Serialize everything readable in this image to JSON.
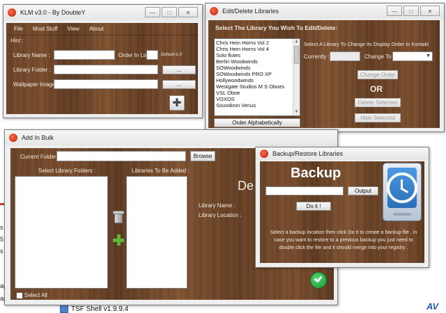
{
  "background": {
    "fragments": [
      "s",
      "5",
      "s v",
      "ap",
      "ap"
    ],
    "taskbar_item": "TSF Shell v1.9.9.4"
  },
  "klm": {
    "title": "KLM v3.0 - By DoubleY",
    "menu": [
      "File",
      "Most Stuff",
      "View",
      "About"
    ],
    "hint_label": "Hint :",
    "library_name_label": "Library Name :",
    "order_in_list_label": "Order In List",
    "default_note": "Default is 0",
    "library_folder_label": "Library Folder :",
    "wallpaper_label": "Wallpaper Image :",
    "browse_label": "...",
    "add_symbol": "✚"
  },
  "edit": {
    "title": "Edit/Delete Libraries",
    "heading": "Select The Library You Wish To Edit/Delete:",
    "libraries": [
      "Chris Hein Horns Vol 2",
      "Chris Hein Horns Vol 4",
      "Solo flutes",
      "Berlin Woodwinds",
      "SOWoodwinds",
      "SOWoodwinds PRO XP",
      "Hollywoodwinds",
      "Westgate Studios M S Oboes",
      "VSL Oboe",
      "VOXOS",
      "Soundiron Venus"
    ],
    "order_button": "Order Alphabetically",
    "order_hint": "Select A Library  To Change Its Display Order In Kontakt",
    "currently_label": "Currently :",
    "change_to_label": "Change To :",
    "change_order_button": "Change Order",
    "or_label": "OR",
    "delete_button": "Delete Selected",
    "hide_button": "Hide Selected"
  },
  "bulk": {
    "title": "Add In Bulk",
    "current_folder_label": "Current Folder :",
    "browse_button": "Browse",
    "select_folders_label": "Select Library Folders :",
    "to_be_added_label": "Libraries To Be Added :",
    "big_text": "De",
    "library_name_label": "Library Name :",
    "library_location_label": "Library Location :",
    "select_all_label": "Select All"
  },
  "backup": {
    "title": "Backup/Restore Libraries",
    "heading": "Backup",
    "output_button": "Output",
    "doit_button": "Do it !",
    "instructions": "Select a backup location then click Do It to create a backup file , in case you want to restore to a previous backup you just need to double click the file and it should merge into your registry ."
  },
  "logo_text": "AV",
  "colors": {
    "accent_red": "#c23a2f",
    "wood": "#6b4326",
    "check_green": "#1f9a3a"
  }
}
